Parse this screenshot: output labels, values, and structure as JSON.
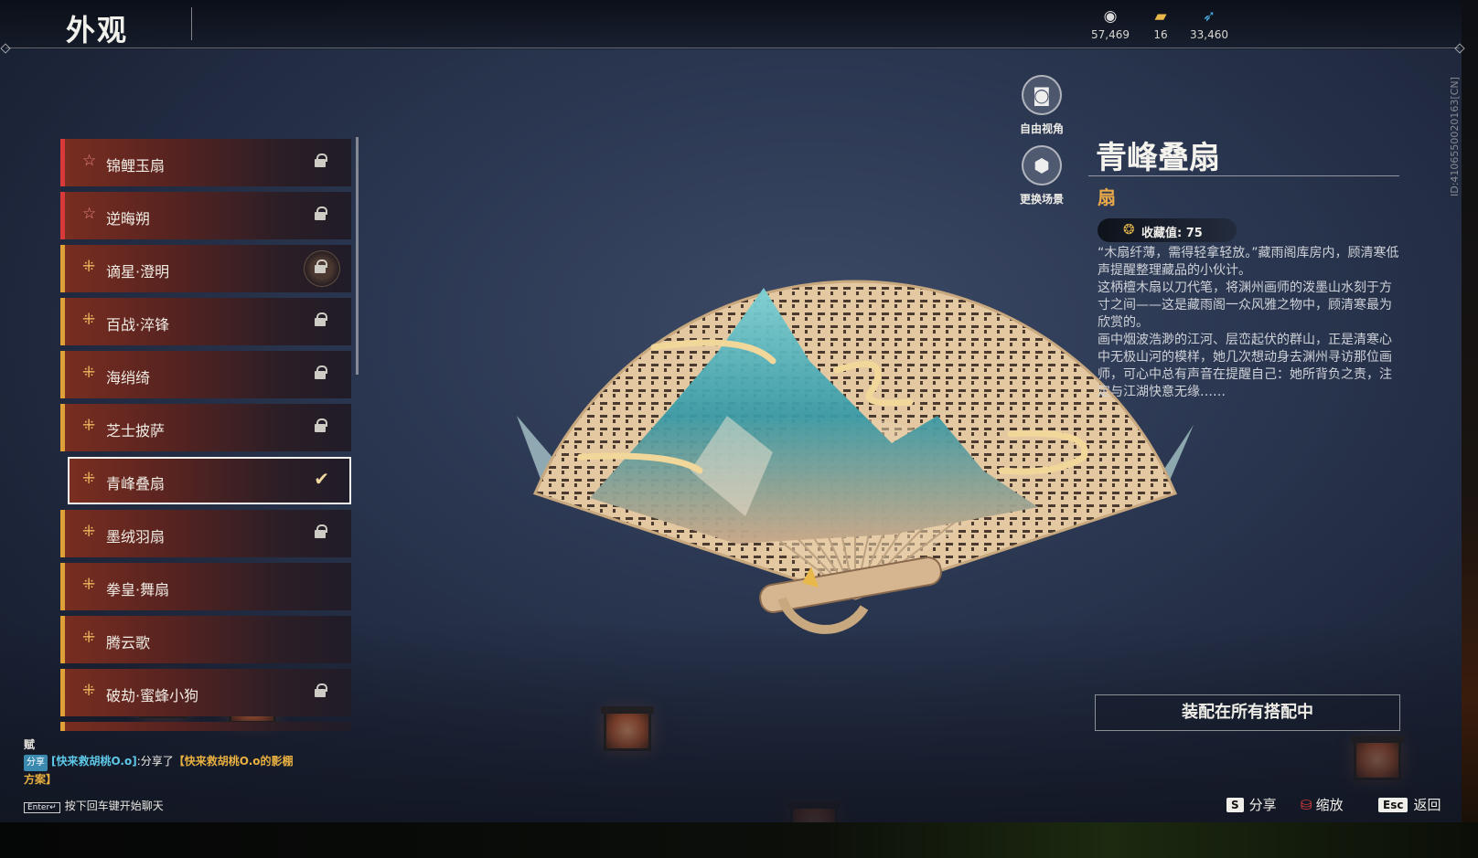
{
  "header": {
    "title": "外观",
    "currencies": [
      {
        "icon": "silver-coin-icon",
        "value": "57,469"
      },
      {
        "icon": "gold-ticket-icon",
        "value": "16"
      },
      {
        "icon": "feather-icon",
        "value": "33,460"
      }
    ]
  },
  "list": {
    "items": [
      {
        "name": "锦鲤玉扇",
        "rarity": "red",
        "state": "locked"
      },
      {
        "name": "逆晦朔",
        "rarity": "red",
        "state": "locked"
      },
      {
        "name": "谪星·澄明",
        "rarity": "gold",
        "state": "locked-ring"
      },
      {
        "name": "百战·淬锋",
        "rarity": "gold",
        "state": "locked"
      },
      {
        "name": "海绡绮",
        "rarity": "gold",
        "state": "locked"
      },
      {
        "name": "芝士披萨",
        "rarity": "gold",
        "state": "locked"
      },
      {
        "name": "青峰叠扇",
        "rarity": "gold",
        "state": "selected"
      },
      {
        "name": "墨绒羽扇",
        "rarity": "gold",
        "state": "locked"
      },
      {
        "name": "拳皇·舞扇",
        "rarity": "gold",
        "state": "owned"
      },
      {
        "name": "腾云歌",
        "rarity": "gold",
        "state": "owned"
      },
      {
        "name": "破劫·蜜蜂小狗",
        "rarity": "gold",
        "state": "locked"
      }
    ]
  },
  "view_controls": {
    "free_camera": "自由视角",
    "change_scene": "更换场景"
  },
  "detail": {
    "title": "青峰叠扇",
    "type": "扇",
    "collect_label": "收藏值: 75",
    "description": [
      "“木扇纤薄，需得轻拿轻放。”藏雨阁库房内，顾清寒低声提醒整理藏品的小伙计。",
      "这柄檀木扇以刀代笔，将渊州画师的泼墨山水刻于方寸之间——这是藏雨阁一众风雅之物中，顾清寒最为欣赏的。",
      "画中烟波浩渺的江河、层峦起伏的群山，正是清寒心中无极山河的模样，她几次想动身去渊州寻访那位画师，可心中总有声音在提醒自己：她所背负之责，注定与江湖快意无缘……"
    ],
    "equip_button": "装配在所有搭配中"
  },
  "side_id": "ID:4106550020163[CN]",
  "hints": {
    "share_key": "S",
    "share": "分享",
    "zoom": "缩放",
    "back_key": "Esc",
    "back": "返回"
  },
  "chat": {
    "line0": "赋",
    "tag": "分享",
    "user": "[快来救胡桃O.o]",
    "action": ":分享了",
    "highlight": "【快来救胡桃O.o的影棚方案】",
    "input_key": "Enter↵",
    "input_hint": "按下回车键开始聊天"
  },
  "colors": {
    "accent_gold": "#e8a84a",
    "rarity_red": "#d83a3a",
    "rarity_gold": "#e0a038",
    "user_cyan": "#5ec8e8"
  }
}
